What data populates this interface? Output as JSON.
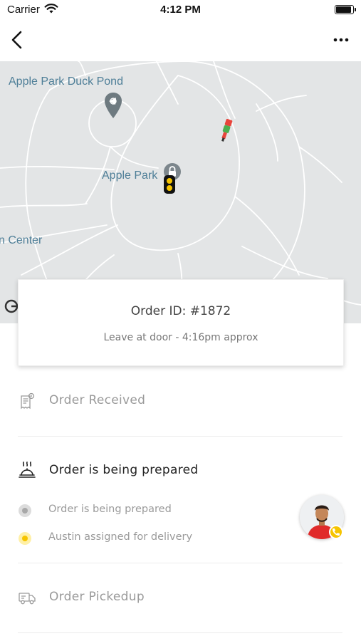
{
  "status_bar": {
    "carrier": "Carrier",
    "time": "4:12 PM",
    "wifi_icon": "wifi-icon",
    "battery_icon": "battery-icon"
  },
  "nav_bar": {
    "back_icon": "chevron-left-icon",
    "more_icon": "more-horizontal-icon"
  },
  "map": {
    "labels": {
      "duck_pond": "Apple Park Duck Pond",
      "park": "Apple Park",
      "center": "n Center"
    },
    "icons": [
      "map-pin-icon",
      "lock-icon",
      "rider-icon",
      "courier-icon",
      "google-logo-icon"
    ]
  },
  "order": {
    "id_text": "Order ID: #1872",
    "subtitle": "Leave at door - 4:16pm approx"
  },
  "steps": {
    "received": {
      "label": "Order Received",
      "icon": "receipt-icon"
    },
    "prepared": {
      "label": "Order is being prepared",
      "icon": "food-tray-icon",
      "sub_items": [
        {
          "label": "Order is being prepared",
          "dot": "grey"
        },
        {
          "label": "Austin assigned for delivery",
          "dot": "yellow"
        }
      ]
    },
    "pickedup": {
      "label": "Order Pickedup",
      "icon": "delivery-truck-icon"
    }
  },
  "courier": {
    "avatar_icon": "avatar",
    "call_icon": "phone-icon"
  },
  "colors": {
    "map_bg": "#e3e5e6",
    "road": "#ffffff",
    "map_label": "#4f7f98",
    "accent_yellow": "#f6c400",
    "muted_text": "#9a9a9a",
    "active_text": "#222222"
  }
}
